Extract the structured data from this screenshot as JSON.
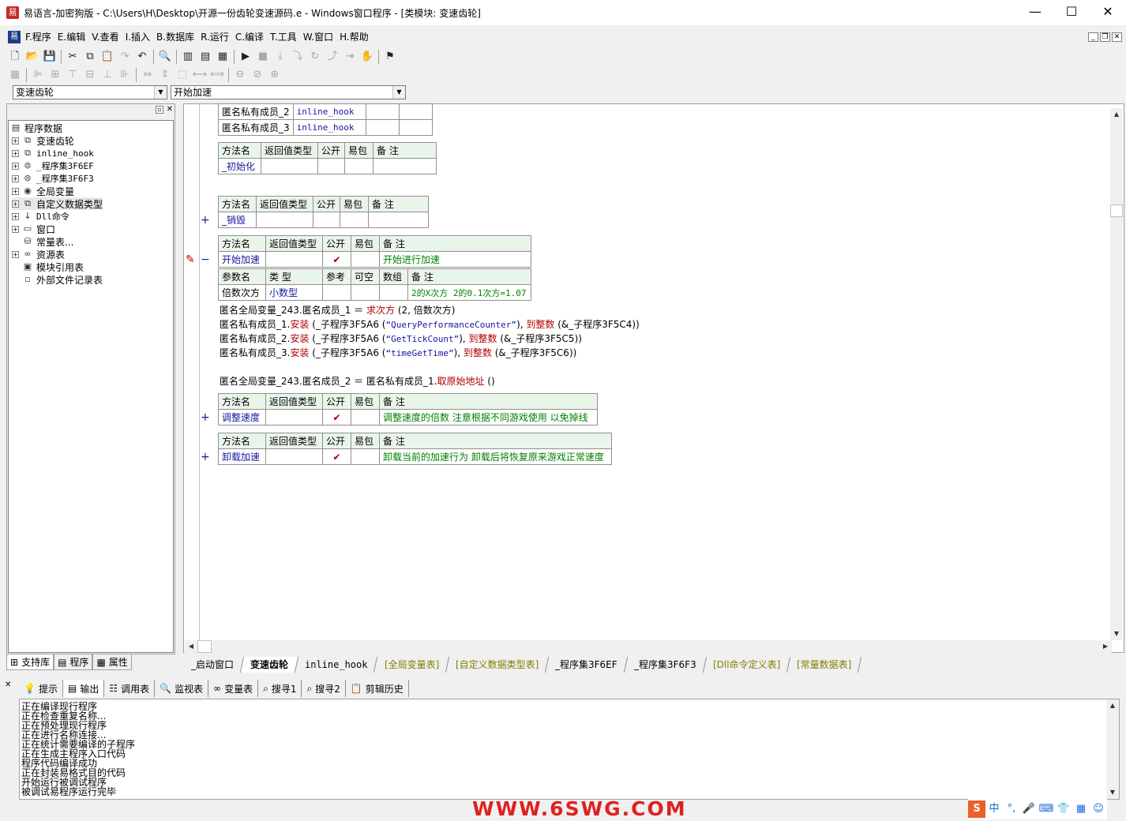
{
  "window": {
    "title": "易语言-加密狗版 - C:\\Users\\H\\Desktop\\开源一份齿轮变速源码.e - Windows窗口程序 - [类模块: 变速齿轮]",
    "minimize": "—",
    "maximize": "☐",
    "close": "✕"
  },
  "menu": [
    "F.程序",
    "E.编辑",
    "V.查看",
    "I.插入",
    "B.数据库",
    "R.运行",
    "C.编译",
    "T.工具",
    "W.窗口",
    "H.帮助"
  ],
  "combos": {
    "module": "变速齿轮",
    "method": "开始加速"
  },
  "tree": {
    "root": "程序数据",
    "items": [
      "变速齿轮",
      "inline_hook",
      "_程序集3F6EF",
      "_程序集3F6F3",
      "全局变量",
      "自定义数据类型",
      "Dll命令",
      "窗口",
      "常量表...",
      "资源表",
      "模块引用表",
      "外部文件记录表"
    ]
  },
  "left_tabs": [
    "支持库",
    "程序",
    "属性"
  ],
  "code": {
    "members": [
      {
        "name": "匿名私有成员_2",
        "type": "inline_hook"
      },
      {
        "name": "匿名私有成员_3",
        "type": "inline_hook"
      }
    ],
    "method_header": [
      "方法名",
      "返回值类型",
      "公开",
      "易包",
      "备 注"
    ],
    "param_header": [
      "参数名",
      "类 型",
      "参考",
      "可空",
      "数组",
      "备 注"
    ],
    "methods": [
      {
        "name": "_初始化",
        "public": "",
        "note": "",
        "fold": ""
      },
      {
        "name": "_销毁",
        "public": "",
        "note": "",
        "fold": "+"
      },
      {
        "name": "开始加速",
        "public": "✔",
        "note": "开始进行加速",
        "fold": "−"
      },
      {
        "name": "调整速度",
        "public": "✔",
        "note": "调整速度的倍数 注意根据不同游戏使用 以免掉线",
        "fold": "+"
      },
      {
        "name": "卸载加速",
        "public": "✔",
        "note": "卸载当前的加速行为 卸载后将恢复原来游戏正常速度",
        "fold": "+"
      }
    ],
    "param": {
      "name": "倍数次方",
      "type": "小数型",
      "note": "2的X次方 2的0.1次方=1.07"
    },
    "lines": {
      "l1_a": "匿名全局变量_243.匿名成员_1 ＝ ",
      "l1_b": "求次方",
      "l1_c": " (2, 倍数次方)",
      "l2_a": "匿名私有成员_1.",
      "l2_b": "安装",
      "l2_c": " (_子程序3F5A6 (",
      "l2_d": "“QueryPerformanceCounter”",
      "l2_e": "), ",
      "l2_f": "到整数",
      "l2_g": " (&_子程序3F5C4))",
      "l3_a": "匿名私有成员_2.",
      "l3_b": "安装",
      "l3_c": " (_子程序3F5A6 (",
      "l3_d": "“GetTickCount”",
      "l3_e": "), ",
      "l3_f": "到整数",
      "l3_g": " (&_子程序3F5C5))",
      "l4_a": "匿名私有成员_3.",
      "l4_b": "安装",
      "l4_c": " (_子程序3F5A6 (",
      "l4_d": "“timeGetTime”",
      "l4_e": "), ",
      "l4_f": "到整数",
      "l4_g": " (&_子程序3F5C6))",
      "l5_a": "匿名全局变量_243.匿名成员_2 ＝ 匿名私有成员_1.",
      "l5_b": "取原始地址",
      "l5_c": " ()"
    }
  },
  "file_tabs": [
    "_启动窗口",
    "变速齿轮",
    "inline_hook",
    "[全局变量表]",
    "[自定义数据类型表]",
    "_程序集3F6EF",
    "_程序集3F6F3",
    "[Dll命令定义表]",
    "[常量数据表]"
  ],
  "bottom_tabs": [
    "提示",
    "输出",
    "调用表",
    "监视表",
    "变量表",
    "搜寻1",
    "搜寻2",
    "剪辑历史"
  ],
  "output": [
    "正在编译现行程序",
    "正在检查重复名称...",
    "正在预处理现行程序",
    "正在进行名称连接...",
    "正在统计需要编译的子程序",
    "正在生成主程序入口代码",
    "程序代码编译成功",
    "正在封装易格式目的代码",
    "开始运行被调试程序",
    "被调试易程序运行完毕"
  ],
  "watermark": "WWW.6SWG.COM",
  "ime": {
    "lang": "中"
  },
  "colors": {
    "keyword": "#b00000",
    "type": "#1515a0",
    "comment": "#008000",
    "header_bg": "#eaf5ea"
  }
}
